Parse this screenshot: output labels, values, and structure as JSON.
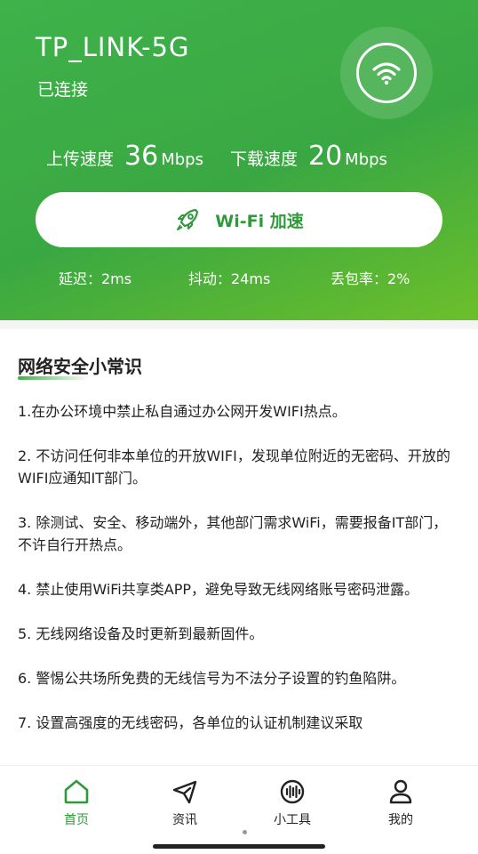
{
  "network": {
    "ssid": "TP_LINK-5G",
    "status": "已连接"
  },
  "speed": {
    "upload_label": "上传速度",
    "upload_value": "36",
    "upload_unit": "Mbps",
    "download_label": "下载速度",
    "download_value": "20",
    "download_unit": "Mbps"
  },
  "boost": {
    "label": "Wi-Fi 加速"
  },
  "stats": {
    "latency": "延迟：2ms",
    "jitter": "抖动：24ms",
    "loss": "丢包率：2%"
  },
  "tips": {
    "title": "网络安全小常识",
    "items": [
      "1.在办公环境中禁止私自通过办公网开发WIFI热点。",
      "2. 不访问任何非本单位的开放WIFI，发现单位附近的无密码、开放的WIFI应通知IT部门。",
      "3. 除测试、安全、移动端外，其他部门需求WiFi，需要报备IT部门，不许自行开热点。",
      "4. 禁止使用WiFi共享类APP，避免导致无线网络账号密码泄露。",
      "5. 无线网络设备及时更新到最新固件。",
      "6. 警惕公共场所免费的无线信号为不法分子设置的钓鱼陷阱。",
      "7. 设置高强度的无线密码，各单位的认证机制建议采取"
    ]
  },
  "tabs": [
    {
      "label": "首页",
      "icon": "home-icon"
    },
    {
      "label": "资讯",
      "icon": "send-icon"
    },
    {
      "label": "小工具",
      "icon": "tools-icon"
    },
    {
      "label": "我的",
      "icon": "user-icon"
    }
  ],
  "colors": {
    "accent": "#2f9a3a",
    "header_start": "#3fb24a",
    "header_end": "#6cbf2a"
  }
}
